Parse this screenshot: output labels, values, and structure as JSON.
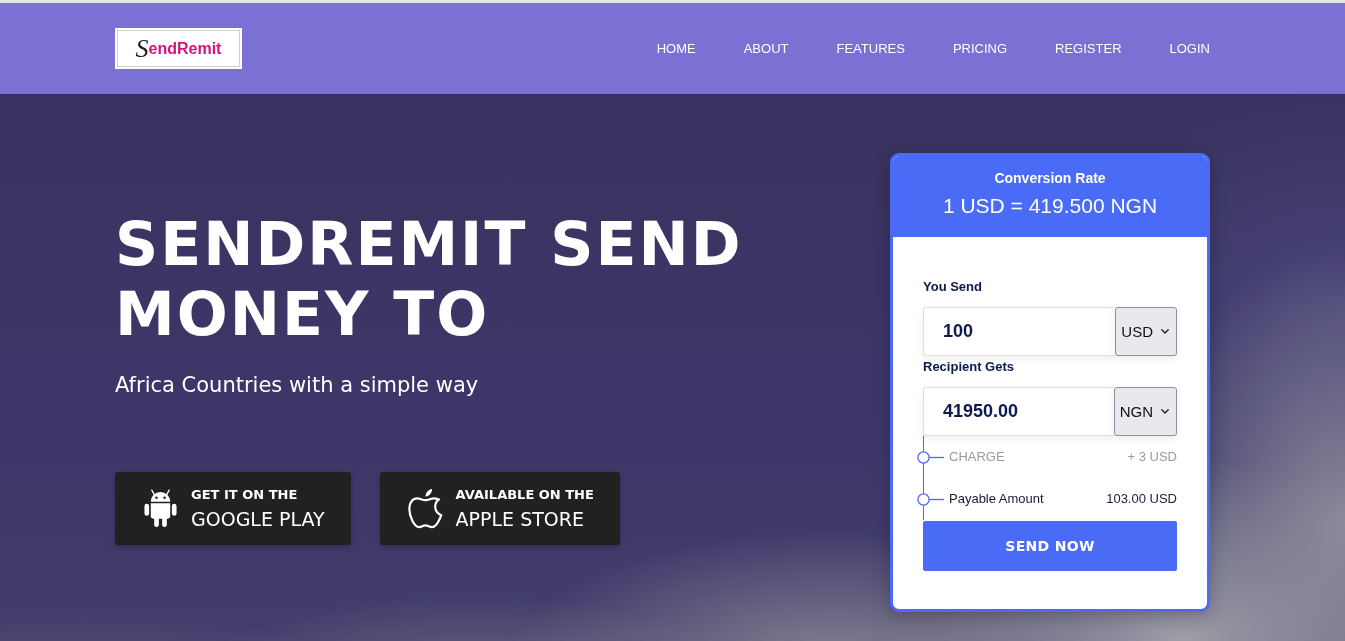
{
  "header": {
    "logo": "SendRemit",
    "nav": [
      "HOME",
      "ABOUT",
      "FEATURES",
      "PRICING",
      "REGISTER",
      "LOGIN"
    ]
  },
  "hero": {
    "title": "SENDREMIT SEND MONEY TO",
    "subtitle": "Africa Countries with a simple way",
    "store_buttons": [
      {
        "kind": "android",
        "caption": "GET IT ON THE",
        "label": "GOOGLE PLAY"
      },
      {
        "kind": "apple",
        "caption": "AVAILABLE ON THE",
        "label": "APPLE STORE"
      }
    ]
  },
  "converter": {
    "rate_label": "Conversion Rate",
    "rate": "1 USD = 419.500 NGN",
    "fields": [
      {
        "label": "You Send",
        "value": "100",
        "currency": "USD"
      },
      {
        "label": "Recipient Gets",
        "value": "41950.00",
        "currency": "NGN"
      }
    ],
    "summary": [
      {
        "label": "CHARGE",
        "value": "+ 3 USD",
        "muted": true
      },
      {
        "label": "Payable Amount",
        "value": "103.00 USD",
        "muted": false
      }
    ],
    "button": "SEND NOW"
  }
}
